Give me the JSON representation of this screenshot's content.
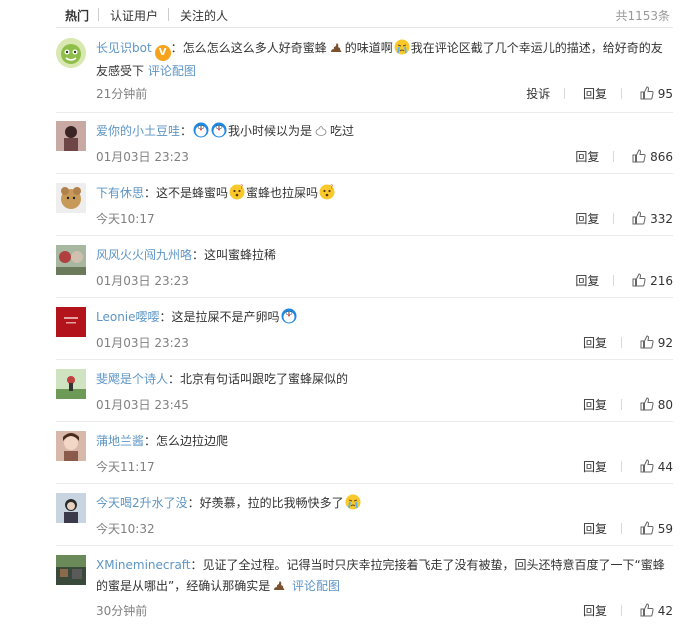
{
  "tabs": {
    "hot": "热门",
    "verified": "认证用户",
    "following": "关注的人"
  },
  "total_count": "共1153条",
  "actions": {
    "report": "投诉",
    "reply": "回复"
  },
  "comments": [
    {
      "user": "长见识bot",
      "parts": [
        "怎么怎么这么多人好奇蜜蜂",
        "的味道啊",
        "我在评论区截了几个幸运儿的描述，给好奇的友友感受下"
      ],
      "link": "评论配图",
      "time": "21分钟前",
      "likes": "95"
    },
    {
      "user": "爱你的小土豆哇",
      "parts": [
        "",
        "我小时候以为是",
        "吃过"
      ],
      "time": "01月03日 23:23",
      "likes": "866"
    },
    {
      "user": "下有休思",
      "parts": [
        "这不是蜂蜜吗",
        "蜜蜂也拉屎吗"
      ],
      "time": "今天10:17",
      "likes": "332"
    },
    {
      "user": "风风火火闯九州咯",
      "parts": [
        "这叫蜜蜂拉稀"
      ],
      "time": "01月03日 23:23",
      "likes": "216"
    },
    {
      "user": "Leonie嘤嘤",
      "parts": [
        "这是拉屎不是产卵吗"
      ],
      "time": "01月03日 23:23",
      "likes": "92"
    },
    {
      "user": "斐飔是个诗人",
      "parts": [
        "北京有句话叫跟吃了蜜蜂屎似的"
      ],
      "time": "01月03日 23:45",
      "likes": "80"
    },
    {
      "user": "蒲地兰酱",
      "parts": [
        "怎么边拉边爬"
      ],
      "time": "今天11:17",
      "likes": "44"
    },
    {
      "user": "今天喝2升水了没",
      "parts": [
        "好羡慕，拉的比我畅快多了"
      ],
      "time": "今天10:32",
      "likes": "59"
    },
    {
      "user": "XMineminecraft",
      "parts": [
        "见证了全过程。记得当时只庆幸拉完接着飞走了没有被蛰，回头还特意百度了一下“蜜蜂的蜜是从哪出”，经确认那确实是"
      ],
      "link": "评论配图",
      "time": "30分钟前",
      "likes": "42"
    }
  ],
  "colors": {
    "username": "#eb7350",
    "link": "#5d95c5",
    "time": "#808080",
    "badge": "#f7a21b"
  },
  "icons": [
    "verified-v-icon",
    "poop-emoji",
    "crying-emoji",
    "doraemon-emoji",
    "thumbs-up-icon",
    "confused-emoji"
  ]
}
